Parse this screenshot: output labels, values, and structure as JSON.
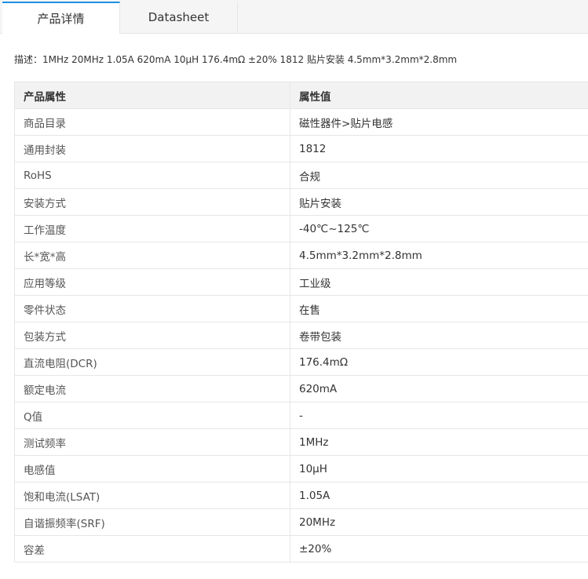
{
  "tabs": [
    {
      "label": "产品详情",
      "active": true
    },
    {
      "label": "Datasheet",
      "active": false
    }
  ],
  "description": "描述：1MHz 20MHz 1.05A 620mA 10μH 176.4mΩ ±20% 1812 贴片安装 4.5mm*3.2mm*2.8mm",
  "table": {
    "headers": [
      "产品属性",
      "属性值"
    ],
    "rows": [
      [
        "商品目录",
        "磁性器件>贴片电感"
      ],
      [
        "通用封装",
        "1812"
      ],
      [
        "RoHS",
        "合规"
      ],
      [
        "安装方式",
        "贴片安装"
      ],
      [
        "工作温度",
        "-40℃~125℃"
      ],
      [
        "长*宽*高",
        "4.5mm*3.2mm*2.8mm"
      ],
      [
        "应用等级",
        "工业级"
      ],
      [
        "零件状态",
        "在售"
      ],
      [
        "包装方式",
        "卷带包装"
      ],
      [
        "直流电阻(DCR)",
        "176.4mΩ"
      ],
      [
        "额定电流",
        "620mA"
      ],
      [
        "Q值",
        "-"
      ],
      [
        "测试频率",
        "1MHz"
      ],
      [
        "电感值",
        "10μH"
      ],
      [
        "饱和电流(LSAT)",
        "1.05A"
      ],
      [
        "自谐振频率(SRF)",
        "20MHz"
      ],
      [
        "容差",
        "±20%"
      ]
    ]
  },
  "colors": {
    "accent": "#1e8fe1",
    "header_bg": "#f2f2f2",
    "border": "#e6e6e6"
  }
}
